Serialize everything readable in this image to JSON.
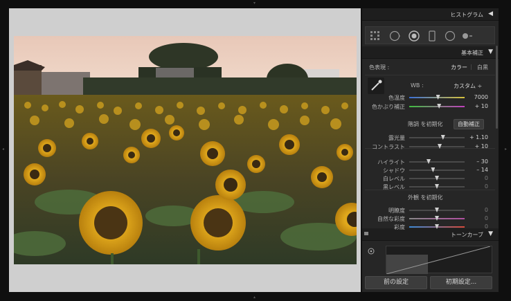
{
  "panel": {
    "histogram_title": "ヒストグラム",
    "basic_title": "基本補正",
    "treatment_label": "色表現 :",
    "treatment_color": "カラー",
    "treatment_bw": "白黒",
    "wb_label": "WB :",
    "wb_value": "カスタム ÷",
    "sliders": [
      {
        "key": "temp",
        "label": "色温度",
        "value": "7000",
        "pos": 0.52,
        "gradient": "linear-gradient(90deg,#3a6fd8,#d8c23a)"
      },
      {
        "key": "tint",
        "label": "色かぶり補正",
        "value": "+ 10",
        "pos": 0.54,
        "gradient": "linear-gradient(90deg,#3fbf3f,#c23fbf)"
      },
      {
        "key": "exposure",
        "label": "露光量",
        "value": "+ 1.10",
        "pos": 0.61
      },
      {
        "key": "contrast",
        "label": "コントラスト",
        "value": "+ 10",
        "pos": 0.55
      },
      {
        "key": "highlights",
        "label": "ハイライト",
        "value": "– 30",
        "pos": 0.35
      },
      {
        "key": "shadows",
        "label": "シャドウ",
        "value": "– 14",
        "pos": 0.43
      },
      {
        "key": "whites",
        "label": "白レベル",
        "value": "0",
        "pos": 0.5
      },
      {
        "key": "blacks",
        "label": "黒レベル",
        "value": "0",
        "pos": 0.5
      },
      {
        "key": "clarity",
        "label": "明瞭度",
        "value": "0",
        "pos": 0.5
      },
      {
        "key": "vibrance",
        "label": "自然な彩度",
        "value": "0",
        "pos": 0.5,
        "gradient": "linear-gradient(90deg,#888,#b04fa0)"
      },
      {
        "key": "saturation",
        "label": "彩度",
        "value": "0",
        "pos": 0.5,
        "gradient": "linear-gradient(90deg,#3a8ad8,#d84a3a)"
      }
    ],
    "tone_label": "階調 を初期化",
    "auto_tone": "自動補正",
    "presence_label": "外観 を初期化",
    "tone_curve_title": "トーンカーブ",
    "prev_button": "前の設定",
    "reset_button": "初期設定..."
  },
  "colors": {
    "accent": "#d8c23a",
    "panel_bg": "#262626"
  }
}
